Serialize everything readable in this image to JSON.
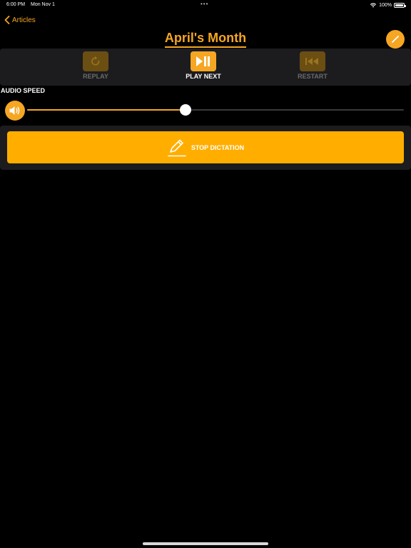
{
  "status_bar": {
    "time": "6:00 PM",
    "date": "Mon Nov 1",
    "dots": "•••",
    "battery_text": "100%",
    "battery_level": 1.0
  },
  "nav": {
    "back_label": "Articles",
    "title": "April's Month"
  },
  "controls": {
    "replay_label": "REPLAY",
    "play_next_label": "PLAY NEXT",
    "restart_label": "RESTART"
  },
  "audio_speed": {
    "label": "AUDIO SPEED",
    "value": 0.42
  },
  "dictation": {
    "button_label": "STOP DICTATION"
  },
  "colors": {
    "accent": "#F5A623",
    "button": "#FFAE00",
    "panel": "#1c1c1e",
    "background": "#000000"
  },
  "icons": {
    "back": "chevron-left-icon",
    "edit": "pencil-icon",
    "replay": "rotate-icon",
    "play_next": "play-pause-icon",
    "restart": "rewind-to-start-icon",
    "volume": "speaker-icon",
    "dictation": "pencil-line-icon",
    "wifi": "wifi-icon",
    "battery": "battery-icon"
  }
}
